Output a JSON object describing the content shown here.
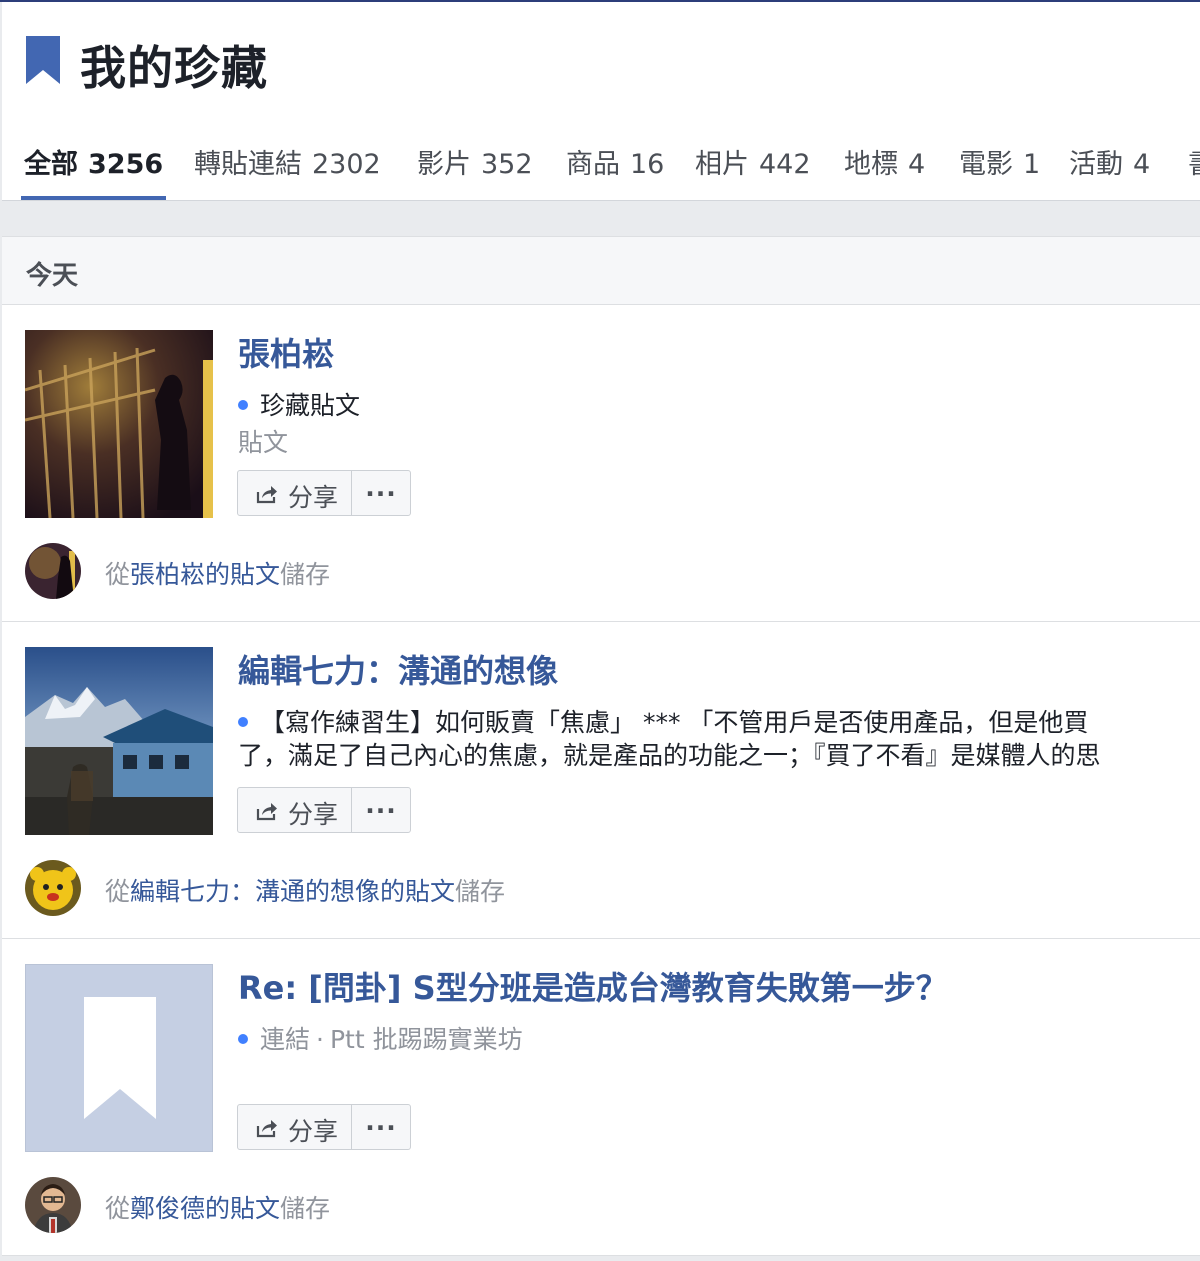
{
  "header": {
    "title": "我的珍藏",
    "accent_color": "#4267b2",
    "tabs": [
      {
        "label": "全部",
        "count": "3256"
      },
      {
        "label": "轉貼連結",
        "count": "2302"
      },
      {
        "label": "影片",
        "count": "352"
      },
      {
        "label": "商品",
        "count": "16"
      },
      {
        "label": "相片",
        "count": "442"
      },
      {
        "label": "地標",
        "count": "4"
      },
      {
        "label": "電影",
        "count": "1"
      },
      {
        "label": "活動",
        "count": "4"
      },
      {
        "label": "書",
        "count": ""
      }
    ]
  },
  "section": {
    "title": "今天"
  },
  "items": [
    {
      "title": "張柏崧",
      "meta": "珍藏貼文",
      "subtype": "貼文",
      "share_label": "分享",
      "more_label": "...",
      "saved_prefix": "從",
      "saved_source": "張柏崧的貼文",
      "saved_suffix": "儲存",
      "thumb_icon": "night-gate-photo",
      "avatar_icon": "person-avatar-icon"
    },
    {
      "title": "編輯七力：溝通的想像",
      "excerpt": "【寫作練習生】如何販賣「焦慮」 *** 「不管用戶是否使用產品，但是他買了，滿足了自己內心的焦慮，就是產品的功能之一；『買了不看』是媒體人的思維」",
      "share_label": "分享",
      "more_label": "...",
      "saved_prefix": "從",
      "saved_source": "編輯七力：溝通的想像的貼文",
      "saved_suffix": "儲存",
      "thumb_icon": "mountain-house-photo",
      "avatar_icon": "yellow-mascot-avatar-icon"
    },
    {
      "title": "Re: [問卦] S型分班是造成台灣教育失敗第一步？",
      "meta_type": "連結",
      "meta_sep": "·",
      "meta_source": "Ptt 批踢踢實業坊",
      "share_label": "分享",
      "more_label": "...",
      "saved_prefix": "從",
      "saved_source": "鄭俊德的貼文",
      "saved_suffix": "儲存",
      "thumb_icon": "bookmark-placeholder-icon",
      "avatar_icon": "person-avatar-icon"
    }
  ]
}
